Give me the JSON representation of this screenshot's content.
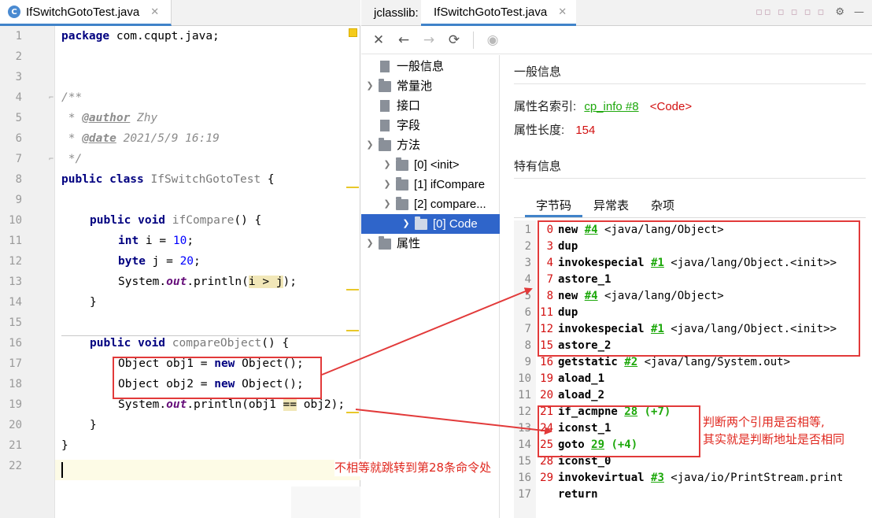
{
  "editor": {
    "tab": {
      "icon": "C",
      "filename": "IfSwitchGotoTest.java",
      "close": "✕"
    },
    "line_numbers": [
      "1",
      "2",
      "3",
      "4",
      "5",
      "6",
      "7",
      "8",
      "9",
      "10",
      "11",
      "12",
      "13",
      "14",
      "15",
      "16",
      "17",
      "18",
      "19",
      "20",
      "21",
      "22"
    ],
    "code": {
      "package_kw": "package",
      "package_name": " com.cqupt.java;",
      "doc_open": "/**",
      "author_prefix": " * ",
      "author_tag": "@author",
      "author_value": " Zhy",
      "date_prefix": " * ",
      "date_tag": "@date",
      "date_value": " 2021/5/9 16:19",
      "doc_close": " */",
      "class_kw": "public class",
      "class_name": " IfSwitchGotoTest",
      "class_brace": " {",
      "m1_kw": "public void",
      "m1_name": " ifCompare",
      "m1_rest": "() {",
      "l11_kw": "int",
      "l11_a": " i = ",
      "l11_num": "10",
      "l11_end": ";",
      "l12_kw": "byte",
      "l12_a": " j = ",
      "l12_num": "20",
      "l12_end": ";",
      "l13_a": "System.",
      "l13_out": "out",
      "l13_b": ".println(",
      "l13_hl": "i > j",
      "l13_end": ");",
      "close_brace_inner": "}",
      "m2_kw": "public void",
      "m2_name": " compareObject",
      "m2_rest": "() {",
      "l17_a": "Object obj1 = ",
      "l17_kw": "new",
      "l17_b": " Object();",
      "l18_a": "Object obj2 = ",
      "l18_kw": "new",
      "l18_b": " Object();",
      "l19_a": "System.",
      "l19_out": "out",
      "l19_b": ".println(obj1 ",
      "l19_hl": "==",
      "l19_c": " obj2);",
      "close_brace_method": "}",
      "close_brace_class": "}"
    }
  },
  "jclasslib": {
    "tabs": {
      "app": "jclasslib:",
      "file": "IfSwitchGotoTest.java",
      "close": "✕"
    },
    "toolbar": {
      "close": "✕",
      "back": "←",
      "forward": "→",
      "refresh": "⟳",
      "web": "◉"
    },
    "tree": {
      "general": "一般信息",
      "constant_pool": "常量池",
      "interfaces": "接口",
      "fields": "字段",
      "methods": "方法",
      "m0": "[0] <init>",
      "m1": "[1] ifCompare",
      "m2": "[2] compare...",
      "code": "[0] Code",
      "attributes": "属性"
    },
    "detail": {
      "general_title": "一般信息",
      "name_index_label": "属性名索引:",
      "name_index_link": "cp_info #8",
      "name_index_value": "<Code>",
      "length_label": "属性长度:",
      "length_value": "154",
      "specific_title": "特有信息",
      "subtabs": [
        "字节码",
        "异常表",
        "杂项"
      ]
    },
    "bytecode": [
      {
        "ln": "1",
        "off": "0",
        "op": "new",
        "ref": "#4",
        "rest": " <java/lang/Object>"
      },
      {
        "ln": "2",
        "off": "3",
        "op": "dup",
        "ref": "",
        "rest": ""
      },
      {
        "ln": "3",
        "off": "4",
        "op": "invokespecial",
        "ref": "#1",
        "rest": " <java/lang/Object.<init>>"
      },
      {
        "ln": "4",
        "off": "7",
        "op": "astore_1",
        "ref": "",
        "rest": ""
      },
      {
        "ln": "5",
        "off": "8",
        "op": "new",
        "ref": "#4",
        "rest": " <java/lang/Object>"
      },
      {
        "ln": "6",
        "off": "11",
        "op": "dup",
        "ref": "",
        "rest": ""
      },
      {
        "ln": "7",
        "off": "12",
        "op": "invokespecial",
        "ref": "#1",
        "rest": " <java/lang/Object.<init>>"
      },
      {
        "ln": "8",
        "off": "15",
        "op": "astore_2",
        "ref": "",
        "rest": ""
      },
      {
        "ln": "9",
        "off": "16",
        "op": "getstatic",
        "ref": "#2",
        "rest": " <java/lang/System.out>"
      },
      {
        "ln": "10",
        "off": "19",
        "op": "aload_1",
        "ref": "",
        "rest": ""
      },
      {
        "ln": "11",
        "off": "20",
        "op": "aload_2",
        "ref": "",
        "rest": ""
      },
      {
        "ln": "12",
        "off": "21",
        "op": "if_acmpne",
        "ref": "28",
        "rest": "",
        "rel": " (+7)"
      },
      {
        "ln": "13",
        "off": "24",
        "op": "iconst_1",
        "ref": "",
        "rest": ""
      },
      {
        "ln": "14",
        "off": "25",
        "op": "goto",
        "ref": "29",
        "rest": "",
        "rel": " (+4)"
      },
      {
        "ln": "15",
        "off": "28",
        "op": "iconst_0",
        "ref": "",
        "rest": ""
      },
      {
        "ln": "16",
        "off": "29",
        "op": "invokevirtual",
        "ref": "#3",
        "rest": " <java/io/PrintStream.print"
      },
      {
        "ln": "17",
        "off": "",
        "op": "return",
        "ref": "",
        "rest": ""
      }
    ]
  },
  "annotations": {
    "note_compare": [
      "判断两个引用是否相等,",
      "其实就是判断地址是否相同"
    ],
    "note_jump": "不相等就跳转到第28条命令处",
    "color": "#e23a3a"
  }
}
